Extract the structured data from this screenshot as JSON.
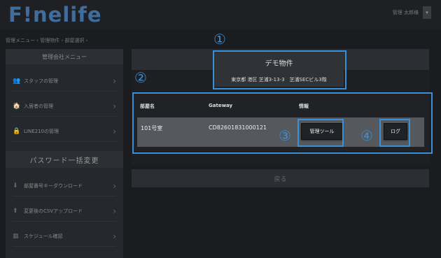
{
  "header": {
    "logo": "F!nelife",
    "user_name": "管理 太郎様",
    "dropdown_icon": "caret-down-icon"
  },
  "breadcrumb": "管理メニュー › 管理物件 › 部屋選択 ›",
  "sidebar": {
    "title": "管理会社メニュー",
    "items": [
      {
        "label": "スタッフの管理",
        "icon": "users-icon"
      },
      {
        "label": "入居者の管理",
        "icon": "residents-icon"
      },
      {
        "label": "LINE210の管理",
        "icon": "lock-icon"
      }
    ],
    "section": "パスワード一括変更",
    "section_items": [
      {
        "label": "部屋番号キーダウンロード",
        "icon": "download-icon"
      },
      {
        "label": "変更後のCSVアップロード",
        "icon": "upload-icon"
      },
      {
        "label": "スケジュール確認",
        "icon": "calendar-icon"
      }
    ]
  },
  "property": {
    "name": "デモ物件",
    "address": "東京都 港区 芝浦3-13-3　芝浦SECビル3階"
  },
  "table": {
    "headers": [
      "部屋名",
      "Gateway",
      "情報"
    ],
    "rows": [
      {
        "room": "101号室",
        "gateway": "CD82601831000121",
        "tool_label": "管理ツール",
        "log_label": "ログ"
      }
    ]
  },
  "back_label": "戻る",
  "callouts": [
    "①",
    "②",
    "③",
    "④"
  ],
  "colors": {
    "accent": "#3b8fd6",
    "logo": "#3f6e9e",
    "background": "#1a1c20"
  }
}
